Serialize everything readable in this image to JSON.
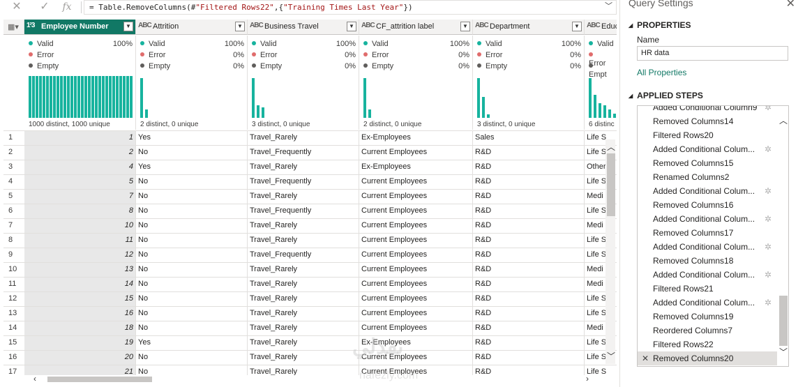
{
  "formula_bar": {
    "cancel_icon": "x-icon",
    "confirm_icon": "check-icon",
    "fx_label": "fx",
    "prefix": "= Table.RemoveColumns(#",
    "arg1": "\"Filtered Rows22\"",
    "mid": ",{",
    "arg2": "\"Training Times Last Year\"",
    "suffix": "})"
  },
  "columns": [
    {
      "type_icon": "1²3",
      "name": "Employee Number",
      "selected": true,
      "valid": "Valid",
      "valid_pct": "100%",
      "error": "Error",
      "error_pct": "",
      "empty": "Empty",
      "empty_pct": "",
      "footer": "1000 distinct, 1000 unique"
    },
    {
      "type_icon": "ABC",
      "name": "Attrition",
      "selected": false,
      "valid": "Valid",
      "valid_pct": "100%",
      "error": "Error",
      "error_pct": "0%",
      "empty": "Empty",
      "empty_pct": "0%",
      "footer": "2 distinct, 0 unique"
    },
    {
      "type_icon": "ABC",
      "name": "Business Travel",
      "selected": false,
      "valid": "Valid",
      "valid_pct": "100%",
      "error": "Error",
      "error_pct": "0%",
      "empty": "Empty",
      "empty_pct": "0%",
      "footer": "3 distinct, 0 unique"
    },
    {
      "type_icon": "ABC",
      "name": "CF_attrition label",
      "selected": false,
      "valid": "Valid",
      "valid_pct": "100%",
      "error": "Error",
      "error_pct": "0%",
      "empty": "Empty",
      "empty_pct": "0%",
      "footer": "2 distinct, 0 unique"
    },
    {
      "type_icon": "ABC",
      "name": "Department",
      "selected": false,
      "valid": "Valid",
      "valid_pct": "100%",
      "error": "Error",
      "error_pct": "0%",
      "empty": "Empty",
      "empty_pct": "0%",
      "footer": "3 distinct, 0 unique"
    },
    {
      "type_icon": "ABC",
      "name": "Educ",
      "selected": false,
      "valid": "Valid",
      "valid_pct": "",
      "error": "Error",
      "error_pct": "",
      "empty": "Empt",
      "empty_pct": "",
      "footer": "6 distinc"
    }
  ],
  "colors": {
    "valid": "#17b39e",
    "error": "#e06c6c",
    "empty": "#605e5c",
    "accent": "#117865"
  },
  "rows": [
    [
      "1",
      "1",
      "Yes",
      "Travel_Rarely",
      "Ex-Employees",
      "Sales",
      "Life S"
    ],
    [
      "2",
      "2",
      "No",
      "Travel_Frequently",
      "Current Employees",
      "R&D",
      "Life S"
    ],
    [
      "3",
      "4",
      "Yes",
      "Travel_Rarely",
      "Ex-Employees",
      "R&D",
      "Other"
    ],
    [
      "4",
      "5",
      "No",
      "Travel_Frequently",
      "Current Employees",
      "R&D",
      "Life S"
    ],
    [
      "5",
      "7",
      "No",
      "Travel_Rarely",
      "Current Employees",
      "R&D",
      "Medi"
    ],
    [
      "6",
      "8",
      "No",
      "Travel_Frequently",
      "Current Employees",
      "R&D",
      "Life S"
    ],
    [
      "7",
      "10",
      "No",
      "Travel_Rarely",
      "Current Employees",
      "R&D",
      "Medi"
    ],
    [
      "8",
      "11",
      "No",
      "Travel_Rarely",
      "Current Employees",
      "R&D",
      "Life S"
    ],
    [
      "9",
      "12",
      "No",
      "Travel_Frequently",
      "Current Employees",
      "R&D",
      "Life S"
    ],
    [
      "10",
      "13",
      "No",
      "Travel_Rarely",
      "Current Employees",
      "R&D",
      "Medi"
    ],
    [
      "11",
      "14",
      "No",
      "Travel_Rarely",
      "Current Employees",
      "R&D",
      "Medi"
    ],
    [
      "12",
      "15",
      "No",
      "Travel_Rarely",
      "Current Employees",
      "R&D",
      "Life S"
    ],
    [
      "13",
      "16",
      "No",
      "Travel_Rarely",
      "Current Employees",
      "R&D",
      "Life S"
    ],
    [
      "14",
      "18",
      "No",
      "Travel_Rarely",
      "Current Employees",
      "R&D",
      "Medi"
    ],
    [
      "15",
      "19",
      "Yes",
      "Travel_Rarely",
      "Ex-Employees",
      "R&D",
      "Life S"
    ],
    [
      "16",
      "20",
      "No",
      "Travel_Rarely",
      "Current Employees",
      "R&D",
      "Life S"
    ],
    [
      "17",
      "21",
      "No",
      "Travel_Rarely",
      "Current Employees",
      "R&D",
      "Life S"
    ]
  ],
  "query_settings": {
    "title": "Query Settings",
    "properties_header": "PROPERTIES",
    "name_label": "Name",
    "name_value": "HR data",
    "all_properties_link": "All Properties",
    "applied_steps_header": "APPLIED STEPS",
    "steps": [
      {
        "label": "Added Conditional Column9",
        "gear": true
      },
      {
        "label": "Removed Columns14",
        "gear": false
      },
      {
        "label": "Filtered Rows20",
        "gear": false
      },
      {
        "label": "Added Conditional Colum...",
        "gear": true
      },
      {
        "label": "Removed Columns15",
        "gear": false
      },
      {
        "label": "Renamed Columns2",
        "gear": false
      },
      {
        "label": "Added Conditional Colum...",
        "gear": true
      },
      {
        "label": "Removed Columns16",
        "gear": false
      },
      {
        "label": "Added Conditional Colum...",
        "gear": true
      },
      {
        "label": "Removed Columns17",
        "gear": false
      },
      {
        "label": "Added Conditional Colum...",
        "gear": true
      },
      {
        "label": "Removed Columns18",
        "gear": false
      },
      {
        "label": "Added Conditional Colum...",
        "gear": true
      },
      {
        "label": "Filtered Rows21",
        "gear": false
      },
      {
        "label": "Added Conditional Colum...",
        "gear": true
      },
      {
        "label": "Removed Columns19",
        "gear": false
      },
      {
        "label": "Reordered Columns7",
        "gear": false
      },
      {
        "label": "Filtered Rows22",
        "gear": false
      },
      {
        "label": "Removed Columns20",
        "gear": false,
        "selected": true
      }
    ]
  },
  "watermark": {
    "text": "نفذلي",
    "sub": "nafezly.com"
  }
}
